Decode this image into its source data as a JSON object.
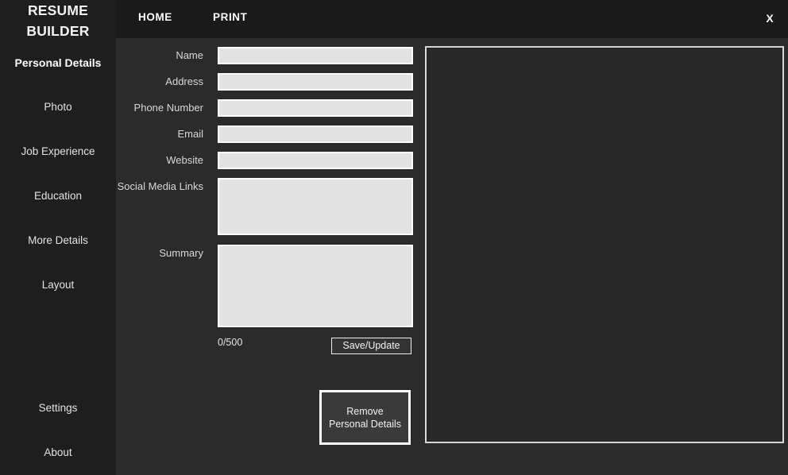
{
  "app": {
    "brand_line1": "RESUME",
    "brand_line2": "BUILDER"
  },
  "topbar": {
    "items": [
      {
        "label": "HOME"
      },
      {
        "label": "PRINT"
      }
    ],
    "close_label": "X"
  },
  "sidebar": {
    "items": [
      {
        "label": "Personal Details",
        "active": true
      },
      {
        "label": "Photo",
        "active": false
      },
      {
        "label": "Job Experience",
        "active": false
      },
      {
        "label": "Education",
        "active": false
      },
      {
        "label": "More Details",
        "active": false
      },
      {
        "label": "Layout",
        "active": false
      },
      {
        "label": "Settings",
        "active": false
      },
      {
        "label": "About",
        "active": false
      }
    ]
  },
  "form": {
    "fields": [
      {
        "label": "Name",
        "value": "",
        "placeholder": ""
      },
      {
        "label": "Address",
        "value": "",
        "placeholder": ""
      },
      {
        "label": "Phone Number",
        "value": "",
        "placeholder": ""
      },
      {
        "label": "Email",
        "value": "",
        "placeholder": ""
      },
      {
        "label": "Website",
        "value": "",
        "placeholder": ""
      },
      {
        "label": "Social Media Links",
        "value": "",
        "placeholder": ""
      },
      {
        "label": "Summary",
        "value": "",
        "placeholder": ""
      }
    ],
    "char_counter": "0/500",
    "save_label": "Save/Update",
    "remove_label": "Remove Personal Details"
  },
  "preview": {
    "content": ""
  },
  "colors": {
    "sidebar_bg": "#1e1e1e",
    "topbar_bg": "#1a1a1a",
    "content_bg": "#2b2b2b",
    "input_bg": "#e2e2e2",
    "input_border": "#ffffff",
    "text": "#e2e2e2"
  }
}
